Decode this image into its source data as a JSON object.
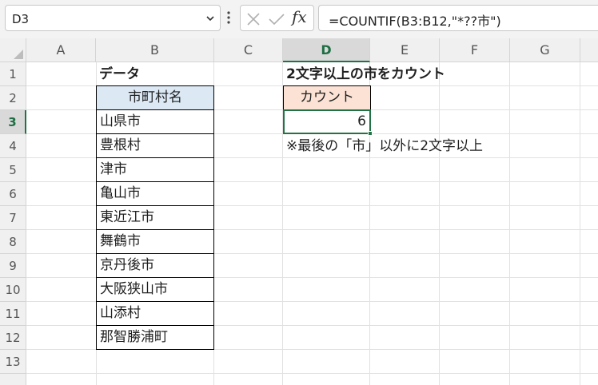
{
  "formula_bar": {
    "name_box": "D3",
    "formula": "=COUNTIF(B3:B12,\"*??市\")",
    "fx_label": "fx"
  },
  "columns": [
    "A",
    "B",
    "C",
    "D",
    "E",
    "F",
    "G"
  ],
  "rows": [
    "1",
    "2",
    "3",
    "4",
    "5",
    "6",
    "7",
    "8",
    "9",
    "10",
    "11",
    "12",
    "13"
  ],
  "selected_cell": {
    "column": "D",
    "row": "3"
  },
  "sheet": {
    "b1_label": "データ",
    "d1_title": "2文字以上の市をカウント",
    "table_header": "市町村名",
    "table_values": [
      "山県市",
      "豊根村",
      "津市",
      "亀山市",
      "東近江市",
      "舞鶴市",
      "京丹後市",
      "大阪狭山市",
      "山添村",
      "那智勝浦町"
    ],
    "count_header": "カウント",
    "count_value": "6",
    "note": "※最後の「市」以外に2文字以上"
  },
  "colors": {
    "accent": "#217346",
    "table_header_fill": "#dce9f5",
    "count_header_fill": "#fbe2d5"
  }
}
